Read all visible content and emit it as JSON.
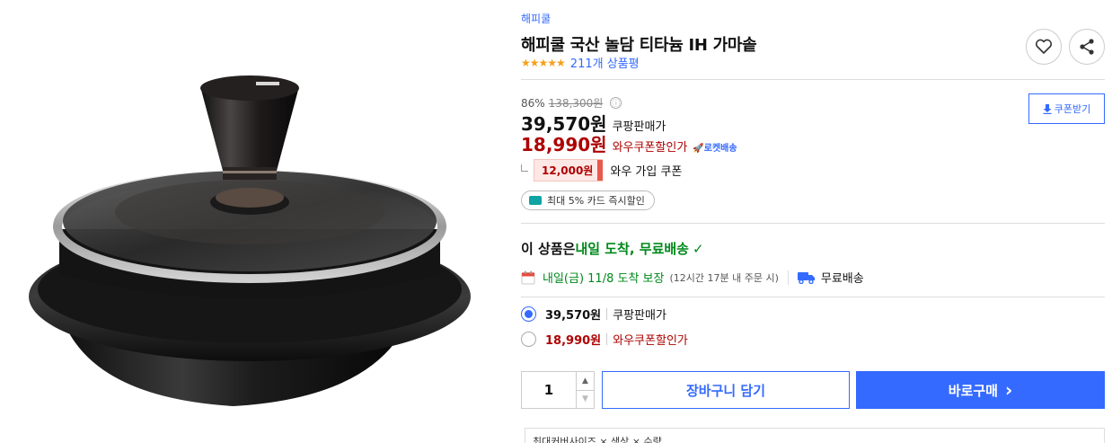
{
  "product": {
    "brand": "해피쿨",
    "title": "해피쿨 국산 놀담 티타늄 IH 가마솥",
    "stars": "★★★★★",
    "review_count": "211개 상품평",
    "rating_stars": 5
  },
  "actions": {
    "like_icon": "heart-icon",
    "share_icon": "share-icon"
  },
  "pricing": {
    "discount_rate": "86%",
    "original_price": "138,300원",
    "info_icon": "ⓘ",
    "coupon_button": "쿠폰받기",
    "sale_price": "39,570원",
    "sale_label": "쿠팡판매가",
    "wow_price": "18,990원",
    "wow_label": "와우쿠폰할인가",
    "rocket_label": "🚀로켓배송",
    "join_coupon_amount": "12,000원",
    "join_coupon_label": "와우 가입 쿠폰",
    "card_discount": "최대 5% 카드 즉시할인"
  },
  "delivery": {
    "headline_prefix": "이 상품은 ",
    "headline_highlight": "내일 도착, 무료배송",
    "check": "✓",
    "arrival": "내일(금) 11/8 도착 보장",
    "arrival_note": "(12시간 17분 내 주문 시)",
    "shipping": "무료배송"
  },
  "options": [
    {
      "price": "39,570원",
      "label": "쿠팡판매가",
      "selected": true
    },
    {
      "price": "18,990원",
      "label": "와우쿠폰할인가",
      "selected": false
    }
  ],
  "purchase": {
    "quantity": "1",
    "up_arrow": "▲",
    "down_arrow": "▼",
    "cart_button": "장바구니 담기",
    "buy_button": "바로구매",
    "buy_arrow": "›"
  },
  "selection_box": {
    "text": "최대커버사이즈 × 색상 × 수량"
  },
  "colors": {
    "accent": "#346aff",
    "price_red": "#ae0000",
    "delivery_green": "#00891a",
    "star": "#f6a01a"
  }
}
